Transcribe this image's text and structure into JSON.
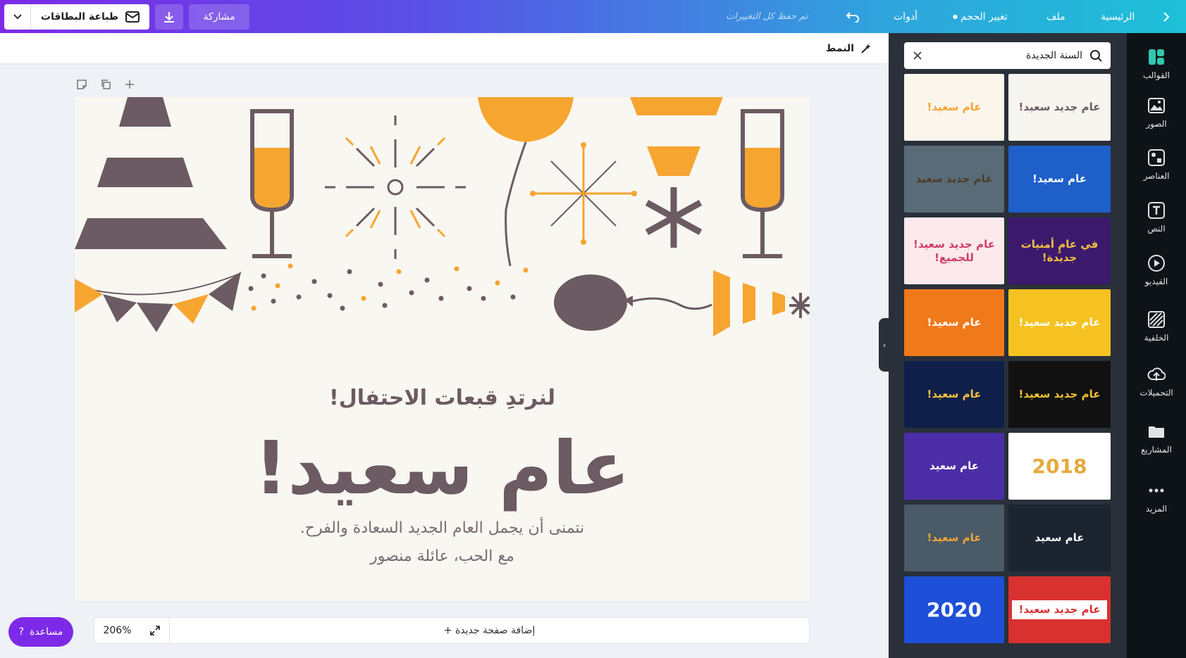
{
  "topbar": {
    "nav_back_icon": "chevron-right-icon",
    "home": "الرئيسية",
    "file": "ملف",
    "resize": "تغيير الحجم",
    "tools": "أدوات",
    "undo_icon": "undo-icon",
    "saved_status": "تم حفظ كل التغييرات",
    "share": "مشاركة",
    "download_icon": "download-icon",
    "print_cards": "طباعة البطاقات",
    "dropdown_icon": "chevron-down-icon"
  },
  "style_bar": {
    "label": "النمط",
    "icon": "magic-wand-icon"
  },
  "canvas": {
    "tools": [
      "note-icon",
      "duplicate-icon",
      "add-icon"
    ],
    "heading_small": "لنرتدِ قبعات الاحتفال!",
    "heading_big": "عام سعيد!",
    "message_line1": "نتمنى أن يجمل العام الجديد السعادة والفرح.",
    "message_line2": "مع الحب، عائلة منصور",
    "colors": {
      "background": "#f9f7f1",
      "purple_gray": "#6c5b62",
      "orange": "#f7a531"
    }
  },
  "bottom": {
    "zoom": "206%",
    "add_page": "+ إضافة صفحة جديدة",
    "help": "مساعدة",
    "help_icon": "question-icon"
  },
  "panel": {
    "search_value": "السنة الجديدة",
    "search_icon": "search-icon",
    "clear_icon": "close-icon",
    "thumbnails": [
      {
        "text": "عام سعيد!",
        "bg": "#fbf6ec",
        "fg": "#f5a531"
      },
      {
        "text": "عام جديد سعيد!",
        "bg": "#f7f5ef",
        "fg": "#6c5b62"
      },
      {
        "text": "عام جديد سعيد",
        "bg": "#5a6b78",
        "fg": "#4a3b2a"
      },
      {
        "text": "عام سعيد!",
        "bg": "#1f5fc9",
        "fg": "#ffffff"
      },
      {
        "text": "عام جديد سعيد! للجميع!",
        "bg": "#fbe9ec",
        "fg": "#d23a6a"
      },
      {
        "text": "في عامٍ أمنيات جديدة!",
        "bg": "#3b1a6e",
        "fg": "#f6c23e"
      },
      {
        "text": "عام سعيد!",
        "bg": "#f07a1a",
        "fg": "#ffffff"
      },
      {
        "text": "عام جديد سعيد!",
        "bg": "#f6c221",
        "fg": "#ffffff"
      },
      {
        "text": "عام سعيد!",
        "bg": "#0f1f4a",
        "fg": "#f6c23e"
      },
      {
        "text": "عام جديد سعيد!",
        "bg": "#111111",
        "fg": "#f2c230"
      },
      {
        "text": "عام سعيد",
        "bg": "#4b2ea6",
        "fg": "#ffffff"
      },
      {
        "text": "2018",
        "bg": "#ffffff",
        "fg": "#e6a93c"
      },
      {
        "text": "عام سعيد!",
        "bg": "#4a5a66",
        "fg": "#f2a53a"
      },
      {
        "text": "عام سعيد",
        "bg": "#1c2430",
        "fg": "#ffffff"
      },
      {
        "text": "2020",
        "bg": "#1d4fd8",
        "fg": "#ffffff"
      },
      {
        "text": "عام جديد سعيد!",
        "bg": "#d9312f",
        "fg": "#d9312f"
      }
    ]
  },
  "sidebar": {
    "items": [
      {
        "label": "القوالب",
        "icon": "templates-icon"
      },
      {
        "label": "الصور",
        "icon": "photos-icon"
      },
      {
        "label": "العناصر",
        "icon": "elements-icon"
      },
      {
        "label": "النص",
        "icon": "text-icon"
      },
      {
        "label": "الفيديو",
        "icon": "video-icon"
      },
      {
        "label": "الخلفية",
        "icon": "background-icon"
      },
      {
        "label": "التحميلات",
        "icon": "uploads-icon"
      },
      {
        "label": "المشاريع",
        "icon": "folder-icon"
      },
      {
        "label": "المزيد",
        "icon": "more-icon"
      }
    ]
  }
}
